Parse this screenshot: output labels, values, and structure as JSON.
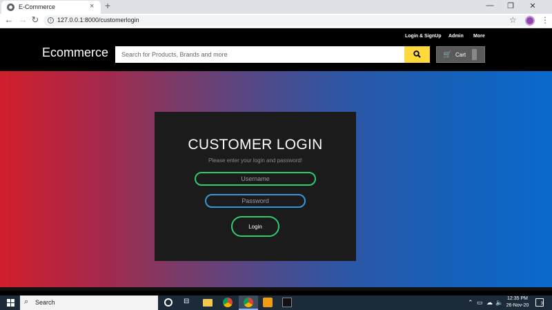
{
  "browser": {
    "tab_title": "E-Commerce",
    "tab_close": "×",
    "new_tab": "+",
    "url": "127.0.0.1:8000/customerlogin",
    "win_minimize": "—",
    "win_restore": "❐",
    "win_close": "✕"
  },
  "site": {
    "brand": "Ecommerce",
    "top_links": [
      "Login & SignUp",
      "Admin",
      "More"
    ],
    "search_placeholder": "Search for Products, Brands and more",
    "cart_label": "Cart",
    "search_button_color": "#ffd93b"
  },
  "login": {
    "title": "CUSTOMER LOGIN",
    "subtitle": "Please enter your login and password!",
    "username_placeholder": "Username",
    "password_placeholder": "Password",
    "button_label": "Login",
    "accent_green": "#2ecc71",
    "accent_blue": "#3498db"
  },
  "taskbar": {
    "search_label": "Search",
    "time": "12:35 PM",
    "date": "26-Nov-20",
    "notification_count": "3"
  },
  "icons": {
    "search": "search-icon",
    "cart": "cart-icon",
    "star": "star-icon",
    "back": "back-arrow-icon",
    "forward": "forward-arrow-icon",
    "reload": "reload-icon"
  }
}
